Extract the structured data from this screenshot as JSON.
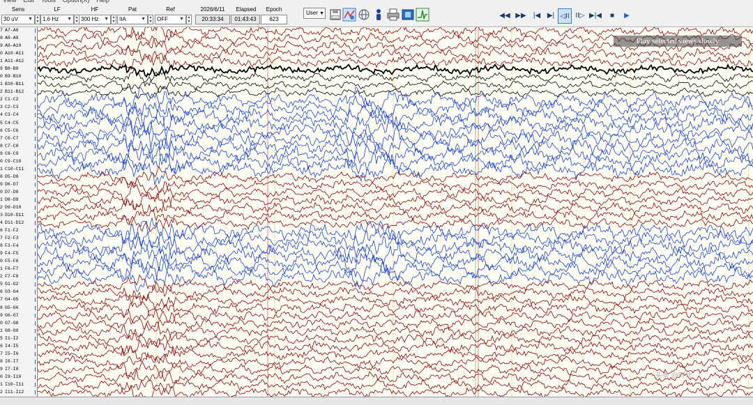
{
  "menu": [
    "View",
    "Edit",
    "Tools",
    "Option(X)",
    "Help"
  ],
  "controls": {
    "sens": {
      "label": "Sens",
      "value": "30 uV"
    },
    "lf": {
      "label": "LF",
      "value": "1.6 Hz"
    },
    "hf": {
      "label": "HF",
      "value": "300 Hz"
    },
    "pat": {
      "label": "Pat",
      "value": "IIA"
    },
    "ref": {
      "label": "Ref",
      "value": "OFF"
    },
    "date": "2026/6/11",
    "time": "20:33:34",
    "elapsed": {
      "label": "Elapsed",
      "value": "01:43:43"
    },
    "epoch": {
      "label": "Epoch",
      "value": "623"
    },
    "user": "User"
  },
  "tools": [
    "save-icon",
    "montage-icon",
    "globe-icon",
    "person-icon",
    "print-icon",
    "report-icon",
    "spike-icon"
  ],
  "playback": [
    {
      "name": "rewind-fast-icon",
      "glyph": "◀◀"
    },
    {
      "name": "forward-fast-icon",
      "glyph": "▶▶"
    },
    {
      "name": "skip-start-icon",
      "glyph": "|◀"
    },
    {
      "name": "skip-end-icon",
      "glyph": "▶|"
    },
    {
      "name": "step-back-icon",
      "glyph": "◁II"
    },
    {
      "name": "step-forward-icon",
      "glyph": "II▷"
    },
    {
      "name": "compress-icon",
      "glyph": "▶|◀"
    },
    {
      "name": "stop-icon",
      "glyph": "■"
    },
    {
      "name": "play-icon",
      "glyph": "▶"
    }
  ],
  "overlay": "Play selected views slowly",
  "watermark": "头条 @时代",
  "channels": [
    {
      "n": "7",
      "label": "A7-A8",
      "color": "#8b0000"
    },
    {
      "n": "8",
      "label": "A8-A9",
      "color": "#8b0000"
    },
    {
      "n": "9",
      "label": "A9-A10",
      "color": "#8b0000"
    },
    {
      "n": "0",
      "label": "A10-A11",
      "color": "#8b0000"
    },
    {
      "n": "1",
      "label": "A11-A12",
      "color": "#8b0000"
    },
    {
      "n": "9",
      "label": "B8-B9",
      "color": "#000000"
    },
    {
      "n": "0",
      "label": "B9-B10",
      "color": "#000000"
    },
    {
      "n": "1",
      "label": "B10-B11",
      "color": "#000000"
    },
    {
      "n": "2",
      "label": "B11-B12",
      "color": "#000000"
    },
    {
      "n": "2",
      "label": "C1-C2",
      "color": "#1a3fd0"
    },
    {
      "n": "3",
      "label": "C2-C3",
      "color": "#1a3fd0"
    },
    {
      "n": "4",
      "label": "C3-C4",
      "color": "#1a3fd0"
    },
    {
      "n": "5",
      "label": "C4-C5",
      "color": "#1a3fd0"
    },
    {
      "n": "6",
      "label": "C5-C6",
      "color": "#1a3fd0"
    },
    {
      "n": "7",
      "label": "C6-C7",
      "color": "#1a3fd0"
    },
    {
      "n": "8",
      "label": "C7-C8",
      "color": "#1a3fd0"
    },
    {
      "n": "9",
      "label": "C8-C9",
      "color": "#1a3fd0"
    },
    {
      "n": "0",
      "label": "C9-C10",
      "color": "#1a3fd0"
    },
    {
      "n": "1",
      "label": "C10-C11",
      "color": "#1a3fd0"
    },
    {
      "n": "8",
      "label": "D5-D6",
      "color": "#8b0000"
    },
    {
      "n": "9",
      "label": "D6-D7",
      "color": "#8b0000"
    },
    {
      "n": "0",
      "label": "D7-D8",
      "color": "#8b0000"
    },
    {
      "n": "1",
      "label": "D8-D9",
      "color": "#8b0000"
    },
    {
      "n": "2",
      "label": "D9-D10",
      "color": "#8b0000"
    },
    {
      "n": "3",
      "label": "D10-D11",
      "color": "#8b0000"
    },
    {
      "n": "4",
      "label": "D11-D12",
      "color": "#8b0000"
    },
    {
      "n": "6",
      "label": "F1-F2",
      "color": "#1a3fd0"
    },
    {
      "n": "7",
      "label": "F2-F3",
      "color": "#1a3fd0"
    },
    {
      "n": "8",
      "label": "F3-F4",
      "color": "#1a3fd0"
    },
    {
      "n": "9",
      "label": "F4-F5",
      "color": "#1a3fd0"
    },
    {
      "n": "0",
      "label": "F5-F6",
      "color": "#1a3fd0"
    },
    {
      "n": "1",
      "label": "F6-F7",
      "color": "#1a3fd0"
    },
    {
      "n": "2",
      "label": "F7-F8",
      "color": "#1a3fd0"
    },
    {
      "n": "5",
      "label": "G1-G2",
      "color": "#8b0000"
    },
    {
      "n": "6",
      "label": "G3-G4",
      "color": "#8b0000"
    },
    {
      "n": "7",
      "label": "G4-G5",
      "color": "#8b0000"
    },
    {
      "n": "8",
      "label": "G5-G6",
      "color": "#8b0000"
    },
    {
      "n": "9",
      "label": "G6-G7",
      "color": "#8b0000"
    },
    {
      "n": "0",
      "label": "G7-G8",
      "color": "#8b0000"
    },
    {
      "n": "1",
      "label": "G8-G9",
      "color": "#8b0000"
    },
    {
      "n": "5",
      "label": "I1-I2",
      "color": "#8b0000"
    },
    {
      "n": "6",
      "label": "I4-I5",
      "color": "#8b0000"
    },
    {
      "n": "7",
      "label": "I5-I6",
      "color": "#8b0000"
    },
    {
      "n": "8",
      "label": "I6-I7",
      "color": "#8b0000"
    },
    {
      "n": "9",
      "label": "I7-I8",
      "color": "#8b0000"
    },
    {
      "n": "0",
      "label": "I9-I10",
      "color": "#8b0000"
    },
    {
      "n": "1",
      "label": "I10-I11",
      "color": "#8b0000"
    },
    {
      "n": "2",
      "label": "I11-I12",
      "color": "#8b0000"
    }
  ]
}
